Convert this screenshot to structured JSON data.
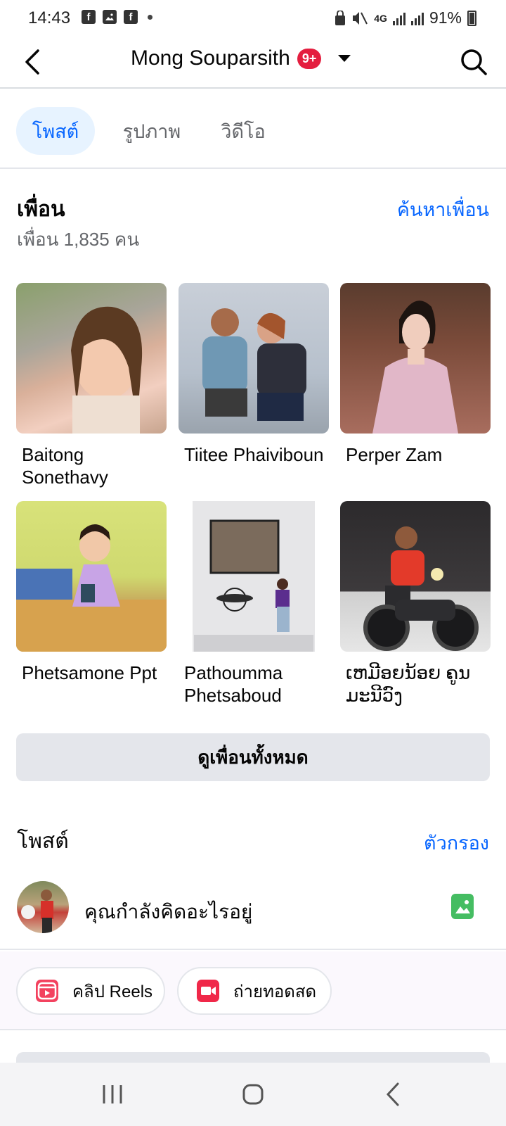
{
  "status_bar": {
    "time": "14:43",
    "notification_icons": [
      "facebook-icon",
      "gallery-icon",
      "facebook-icon"
    ],
    "network": "4G",
    "battery": "91%"
  },
  "header": {
    "title": "Mong Souparsith",
    "notification_badge": "9+"
  },
  "tabs": [
    {
      "label": "โพสต์",
      "active": true
    },
    {
      "label": "รูปภาพ",
      "active": false
    },
    {
      "label": "วิดีโอ",
      "active": false
    }
  ],
  "friends": {
    "title": "เพื่อน",
    "find_link": "ค้นหาเพื่อน",
    "count_text": "เพื่อน 1,835 คน",
    "items": [
      {
        "name": "Baitong Sonethavy"
      },
      {
        "name": "Tiitee Phaiviboun"
      },
      {
        "name": "Perper Zam"
      },
      {
        "name": "Phetsamone Ppt"
      },
      {
        "name": "Pathoumma Phetsaboud"
      },
      {
        "name": "ເຫມີອຍນ້ອຍ ຄູນ ມະນີວົງ"
      }
    ],
    "see_all": "ดูเพื่อนทั้งหมด"
  },
  "posts": {
    "title": "โพสต์",
    "filter_link": "ตัวกรอง",
    "composer_prompt": "คุณกำลังคิดอะไรอยู่",
    "reels_label": "คลิป Reels",
    "live_label": "ถ่ายทอดสด"
  },
  "colors": {
    "accent": "#0866ff",
    "badge": "#e41e3f",
    "photo_icon": "#45bd62",
    "reels_icon": "#f3425f",
    "live_icon": "#f02849"
  }
}
